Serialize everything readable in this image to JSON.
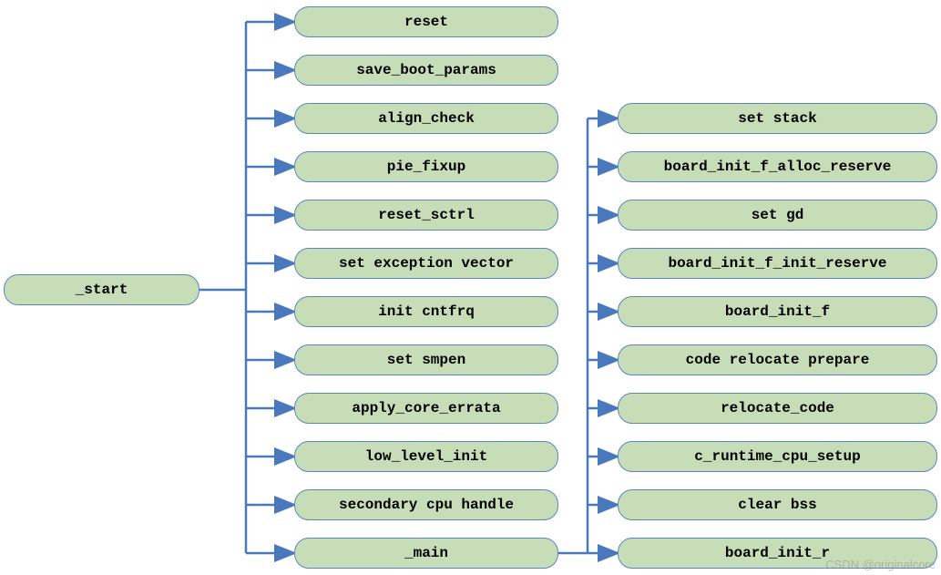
{
  "diagram": {
    "type": "tree",
    "root": {
      "label": "_start"
    },
    "column2": [
      {
        "label": "reset"
      },
      {
        "label": "save_boot_params"
      },
      {
        "label": "align_check"
      },
      {
        "label": "pie_fixup"
      },
      {
        "label": "reset_sctrl"
      },
      {
        "label": "set exception vector"
      },
      {
        "label": "init cntfrq"
      },
      {
        "label": "set smpen"
      },
      {
        "label": "apply_core_errata"
      },
      {
        "label": "low_level_init"
      },
      {
        "label": "secondary cpu handle"
      },
      {
        "label": "_main"
      }
    ],
    "column3": [
      {
        "label": "set stack"
      },
      {
        "label": "board_init_f_alloc_reserve"
      },
      {
        "label": "set gd"
      },
      {
        "label": "board_init_f_init_reserve"
      },
      {
        "label": "board_init_f"
      },
      {
        "label": "code relocate prepare"
      },
      {
        "label": "relocate_code"
      },
      {
        "label": "c_runtime_cpu_setup"
      },
      {
        "label": "clear bss"
      },
      {
        "label": "board_init_r"
      }
    ],
    "connectors": {
      "stroke": "#4a78bd",
      "arrowFill": "#4a78bd"
    }
  },
  "watermark": "CSDN @originalcore"
}
